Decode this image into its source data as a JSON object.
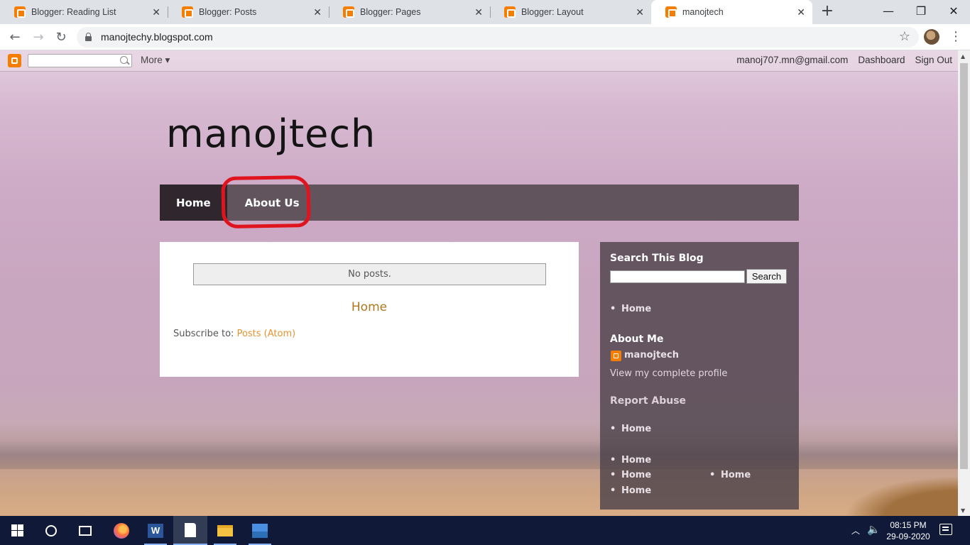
{
  "browser": {
    "tabs": [
      {
        "title": "Blogger: Reading List"
      },
      {
        "title": "Blogger: Posts"
      },
      {
        "title": "Blogger: Pages"
      },
      {
        "title": "Blogger: Layout"
      },
      {
        "title": "manojtech"
      }
    ],
    "active_tab": 4,
    "new_tab_symbol": "+",
    "close_symbol": "✕",
    "url": "manojtechy.blogspot.com",
    "window_controls": {
      "minimize": "—",
      "maximize": "❐",
      "close": "✕"
    }
  },
  "blogger_navbar": {
    "search_placeholder": "",
    "more_label": "More ▾",
    "user_email": "manoj707.mn@gmail.com",
    "dashboard_label": "Dashboard",
    "signout_label": "Sign Out"
  },
  "blog": {
    "title": "manojtech",
    "page_tabs": [
      {
        "label": "Home",
        "selected": true
      },
      {
        "label": "About Us",
        "selected": false
      }
    ],
    "main": {
      "no_posts": "No posts.",
      "home_link": "Home",
      "subscribe_prefix": "Subscribe to: ",
      "subscribe_link": "Posts (Atom)"
    },
    "sidebar": {
      "search_heading": "Search This Blog",
      "search_button": "Search",
      "pages_items": [
        "Home"
      ],
      "about_heading": "About Me",
      "profile_name": "manojtech",
      "view_profile": "View my complete profile",
      "report_abuse": "Report Abuse",
      "lists": [
        [
          "Home"
        ],
        [
          "Home"
        ],
        [
          "Home",
          "Home"
        ],
        [
          "Home"
        ]
      ]
    }
  },
  "taskbar": {
    "word_letter": "W",
    "time": "08:15 PM",
    "date": "29-09-2020"
  },
  "colors": {
    "annotation_red": "#e0141e",
    "blogger_orange": "#f57d00",
    "link_gold": "#b0771e",
    "taskbar_bg": "#101a38"
  }
}
